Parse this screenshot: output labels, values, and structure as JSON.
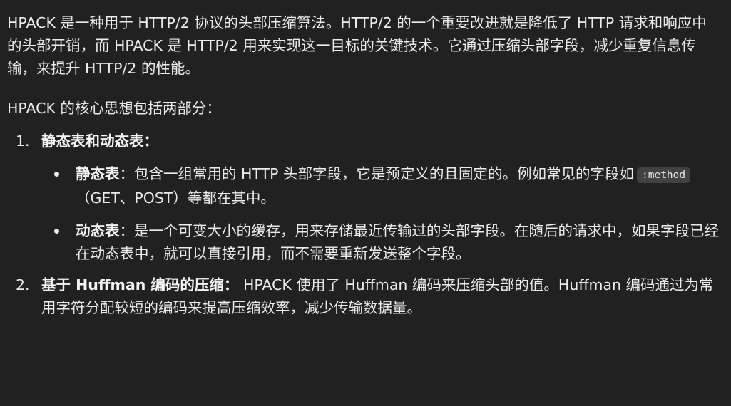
{
  "intro": "HPACK 是一种用于 HTTP/2 协议的头部压缩算法。HTTP/2 的一个重要改进就是降低了 HTTP 请求和响应中的头部开销，而 HPACK 是 HTTP/2 用来实现这一目标的关键技术。它通过压缩头部字段，减少重复信息传输，来提升 HTTP/2 的性能。",
  "lead": "HPACK 的核心思想包括两部分：",
  "list": [
    {
      "number": "1.",
      "title": "静态表和动态表：",
      "bullets": [
        {
          "term": "静态表",
          "text_before": "：包含一组常用的 HTTP 头部字段，它是预定义的且固定的。例如常见的字段如",
          "code": ":method",
          "text_after": "（GET、POST）等都在其中。"
        },
        {
          "term": "动态表",
          "text": "：是一个可变大小的缓存，用来存储最近传输过的头部字段。在随后的请求中，如果字段已经在动态表中，就可以直接引用，而不需要重新发送整个字段。"
        }
      ]
    },
    {
      "number": "2.",
      "title": "基于 Huffman 编码的压缩：",
      "text": " HPACK 使用了 Huffman 编码来压缩头部的值。Huffman 编码通过为常用字符分配较短的编码来提高压缩效率，减少传输数据量。"
    }
  ]
}
